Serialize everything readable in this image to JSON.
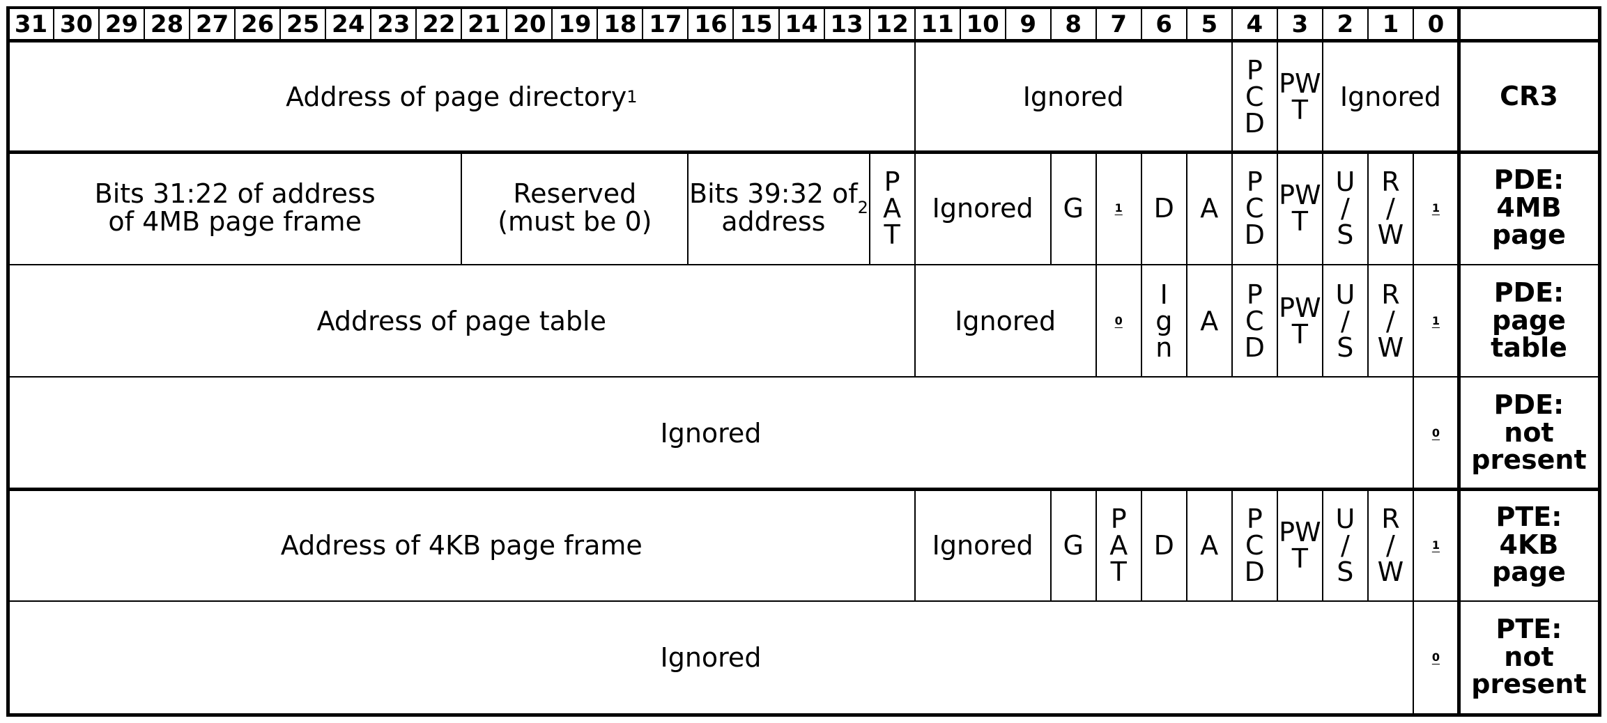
{
  "bit_header": [
    "31",
    "30",
    "29",
    "28",
    "27",
    "26",
    "25",
    "24",
    "23",
    "22",
    "21",
    "20",
    "19",
    "18",
    "17",
    "16",
    "15",
    "14",
    "13",
    "12",
    "11",
    "10",
    "9",
    "8",
    "7",
    "6",
    "5",
    "4",
    "3",
    "2",
    "1",
    "0"
  ],
  "rows": [
    {
      "label": "CR3",
      "fields": [
        {
          "hi": 31,
          "lo": 12,
          "text": "Address of page directory",
          "sup": "1",
          "style": "txt"
        },
        {
          "hi": 11,
          "lo": 5,
          "text": "Ignored",
          "style": "txt"
        },
        {
          "hi": 4,
          "lo": 4,
          "text": "P\nC\nD",
          "style": "vert"
        },
        {
          "hi": 3,
          "lo": 3,
          "text": "PW\nT",
          "style": "pw"
        },
        {
          "hi": 2,
          "lo": 0,
          "text": "Ignored",
          "style": "txt"
        }
      ]
    },
    {
      "label": "PDE:\n4MB\npage",
      "fields": [
        {
          "hi": 31,
          "lo": 22,
          "text": "Bits 31:22 of address\nof 4MB page frame",
          "style": "txt2"
        },
        {
          "hi": 21,
          "lo": 17,
          "text": "Reserved\n(must be 0)",
          "style": "txt2"
        },
        {
          "hi": 16,
          "lo": 13,
          "text": "Bits 39:32 of\naddress",
          "sup": "2",
          "style": "txt2"
        },
        {
          "hi": 12,
          "lo": 12,
          "text": "P\nA\nT",
          "style": "vert"
        },
        {
          "hi": 11,
          "lo": 9,
          "text": "Ignored",
          "style": "txt"
        },
        {
          "hi": 8,
          "lo": 8,
          "text": "G",
          "style": "txt"
        },
        {
          "hi": 7,
          "lo": 7,
          "text": "1",
          "style": "ul"
        },
        {
          "hi": 6,
          "lo": 6,
          "text": "D",
          "style": "txt"
        },
        {
          "hi": 5,
          "lo": 5,
          "text": "A",
          "style": "txt"
        },
        {
          "hi": 4,
          "lo": 4,
          "text": "P\nC\nD",
          "style": "vert"
        },
        {
          "hi": 3,
          "lo": 3,
          "text": "PW\nT",
          "style": "pw"
        },
        {
          "hi": 2,
          "lo": 2,
          "text": "U\n/\nS",
          "style": "vert"
        },
        {
          "hi": 1,
          "lo": 1,
          "text": "R\n/\nW",
          "style": "vert"
        },
        {
          "hi": 0,
          "lo": 0,
          "text": "1",
          "style": "ul"
        }
      ]
    },
    {
      "label": "PDE:\npage\ntable",
      "fields": [
        {
          "hi": 31,
          "lo": 12,
          "text": "Address of page table",
          "style": "txt"
        },
        {
          "hi": 11,
          "lo": 8,
          "text": "Ignored",
          "style": "txt"
        },
        {
          "hi": 7,
          "lo": 7,
          "text": "0",
          "style": "ul"
        },
        {
          "hi": 6,
          "lo": 6,
          "text": "I\ng\nn",
          "style": "vert"
        },
        {
          "hi": 5,
          "lo": 5,
          "text": "A",
          "style": "txt"
        },
        {
          "hi": 4,
          "lo": 4,
          "text": "P\nC\nD",
          "style": "vert"
        },
        {
          "hi": 3,
          "lo": 3,
          "text": "PW\nT",
          "style": "pw"
        },
        {
          "hi": 2,
          "lo": 2,
          "text": "U\n/\nS",
          "style": "vert"
        },
        {
          "hi": 1,
          "lo": 1,
          "text": "R\n/\nW",
          "style": "vert"
        },
        {
          "hi": 0,
          "lo": 0,
          "text": "1",
          "style": "ul"
        }
      ]
    },
    {
      "label": "PDE:\nnot\npresent",
      "fields": [
        {
          "hi": 31,
          "lo": 1,
          "text": "Ignored",
          "style": "txt"
        },
        {
          "hi": 0,
          "lo": 0,
          "text": "0",
          "style": "ul"
        }
      ]
    },
    {
      "label": "PTE:\n4KB\npage",
      "fields": [
        {
          "hi": 31,
          "lo": 12,
          "text": "Address of 4KB page frame",
          "style": "txt"
        },
        {
          "hi": 11,
          "lo": 9,
          "text": "Ignored",
          "style": "txt"
        },
        {
          "hi": 8,
          "lo": 8,
          "text": "G",
          "style": "txt"
        },
        {
          "hi": 7,
          "lo": 7,
          "text": "P\nA\nT",
          "style": "vert"
        },
        {
          "hi": 6,
          "lo": 6,
          "text": "D",
          "style": "txt"
        },
        {
          "hi": 5,
          "lo": 5,
          "text": "A",
          "style": "txt"
        },
        {
          "hi": 4,
          "lo": 4,
          "text": "P\nC\nD",
          "style": "vert"
        },
        {
          "hi": 3,
          "lo": 3,
          "text": "PW\nT",
          "style": "pw"
        },
        {
          "hi": 2,
          "lo": 2,
          "text": "U\n/\nS",
          "style": "vert"
        },
        {
          "hi": 1,
          "lo": 1,
          "text": "R\n/\nW",
          "style": "vert"
        },
        {
          "hi": 0,
          "lo": 0,
          "text": "1",
          "style": "ul"
        }
      ]
    },
    {
      "label": "PTE:\nnot\npresent",
      "fields": [
        {
          "hi": 31,
          "lo": 1,
          "text": "Ignored",
          "style": "txt"
        },
        {
          "hi": 0,
          "lo": 0,
          "text": "0",
          "style": "ul"
        }
      ]
    }
  ]
}
